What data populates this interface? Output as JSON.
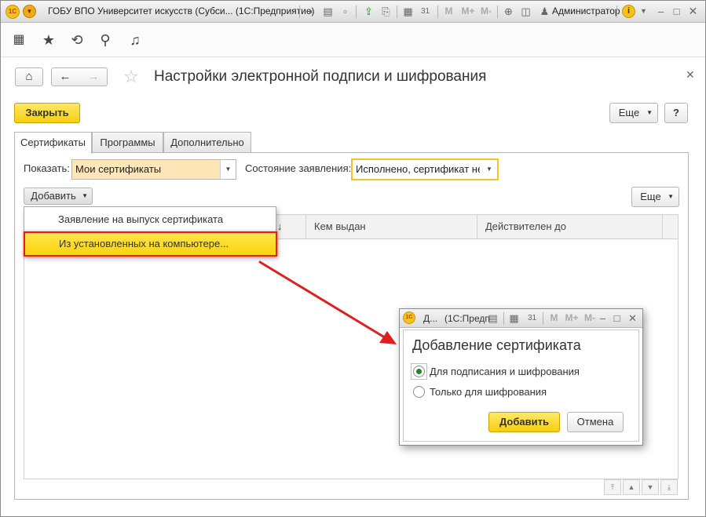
{
  "titlebar": {
    "title": "ГОБУ ВПО Университет искусств (Субси... (1С:Предприятие)",
    "user": "Администратор",
    "logo": "1С",
    "mem_labels": [
      "M",
      "M+",
      "M-"
    ]
  },
  "form": {
    "title": "Настройки электронной подписи и шифрования",
    "close_button": "Закрыть",
    "more_button": "Еще",
    "help_button": "?"
  },
  "tabs": [
    {
      "label": "Сертификаты",
      "active": true
    },
    {
      "label": "Программы",
      "active": false
    },
    {
      "label": "Дополнительно",
      "active": false
    }
  ],
  "filters": {
    "show_label": "Показать:",
    "show_value": "Мои сертификаты",
    "status_label": "Состояние заявления:",
    "status_value": "Исполнено, сертификат не"
  },
  "list_toolbar": {
    "add_button": "Добавить",
    "more_button": "Еще"
  },
  "table": {
    "sort_arrow": "↓",
    "columns": [
      "Кем выдан",
      "Действителен до"
    ]
  },
  "add_menu": {
    "items": [
      {
        "label": "Заявление на выпуск сертификата",
        "highlighted": false
      },
      {
        "label": "Из установленных на компьютере...",
        "highlighted": true
      }
    ]
  },
  "dialog": {
    "title_short": "Д...",
    "title_app": "(1С:Предп",
    "logo": "1С",
    "mem_labels": [
      "M",
      "M+",
      "M-"
    ],
    "heading": "Добавление сертификата",
    "options": [
      {
        "label": "Для подписания и шифрования",
        "checked": true
      },
      {
        "label": "Только для шифрования",
        "checked": false
      }
    ],
    "add_button": "Добавить",
    "cancel_button": "Отмена"
  },
  "colors": {
    "accent_yellow": "#f5cf0e",
    "highlight_red": "#e02020",
    "radio_green": "#2e7d32"
  }
}
